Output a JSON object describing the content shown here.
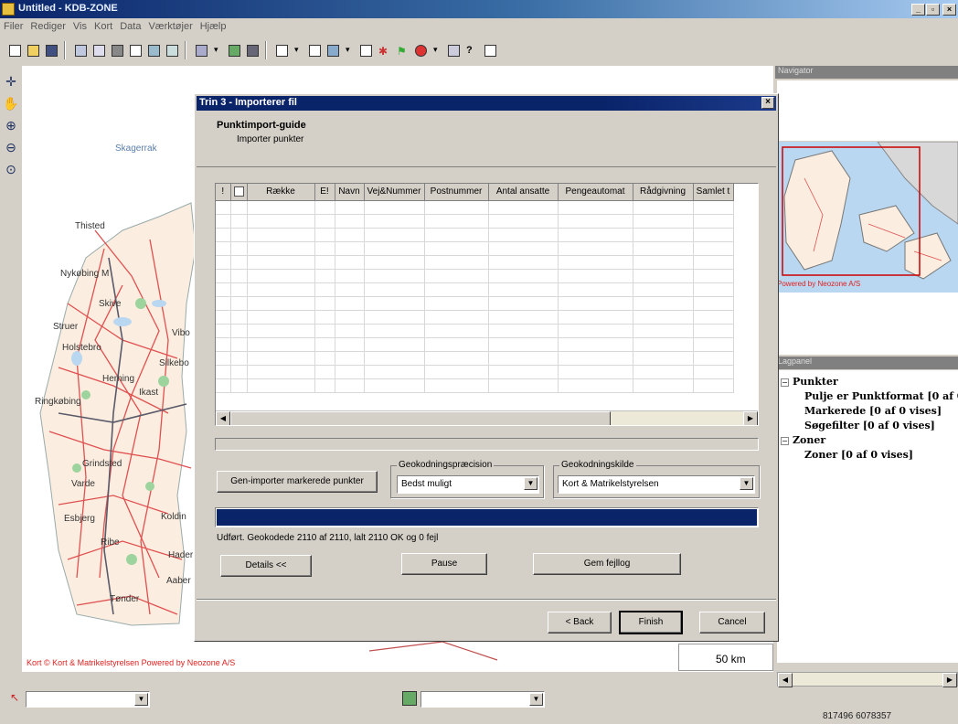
{
  "app": {
    "title": "Untitled - KDB-ZONE",
    "menu": [
      "Filer",
      "Rediger",
      "Vis",
      "Kort",
      "Data",
      "Værktøjer",
      "Hjælp"
    ]
  },
  "map": {
    "labels": {
      "skagerrak": "Skagerrak",
      "thisted": "Thisted",
      "nykobing": "Nykøbing M",
      "skive": "Skive",
      "viborg": "Vibo",
      "struer": "Struer",
      "holstebro": "Holstebro",
      "herning": "Herning",
      "silkeborg": "Silkebo",
      "ringkobing": "Ringkøbing",
      "ikast": "Ikast",
      "grindsted": "Grindsted",
      "varde": "Varde",
      "esbjerg": "Esbjerg",
      "kolding": "Koldin",
      "ribe": "Ribe",
      "haderslev": "Hader",
      "aabenraa": "Aaber",
      "tonder": "Tønder"
    },
    "credit": "Kort © Kort & Matrikelstyrelsen Powered by Neozone A/S",
    "scale": "50 km"
  },
  "navigator": {
    "title": "Navigator",
    "credit": "Powered by Neozone A/S"
  },
  "layers": {
    "title": "Lagpanel",
    "groups": [
      {
        "label": "Punkter",
        "expander": "−",
        "children": [
          "Pulje er Punktformat [0 af 0",
          "Markerede [0 af 0 vises]",
          "Søgefilter [0 af 0 vises]"
        ]
      },
      {
        "label": "Zoner",
        "expander": "−",
        "children": [
          "Zoner [0 af 0 vises]"
        ]
      }
    ]
  },
  "statusbar": {
    "coords": "817496 6078357"
  },
  "dialog": {
    "title": "Trin 3 - Importerer fil",
    "close": "×",
    "heading": "Punktimport-guide",
    "subheading": "Importer punkter",
    "grid": {
      "columns": [
        "!",
        "",
        "Række",
        "E!",
        "Navn",
        "Vej&Nummer",
        "Postnummer",
        "Antal ansatte",
        "Pengeautomat",
        "Rådgivning",
        "Samlet t"
      ],
      "empty_rows": 14
    },
    "regen_button": "Gen-importer markerede punkter",
    "precision": {
      "legend": "Geokodningspræcision",
      "value": "Bedst muligt"
    },
    "source": {
      "legend": "Geokodningskilde",
      "value": "Kort & Matrikelstyrelsen"
    },
    "progress": 1.0,
    "status": "Udført. Geokodede 2110 af 2110, lalt 2110 OK og 0 fejl",
    "details_button": "Details <<",
    "pause_button": "Pause",
    "save_log_button": "Gem fejllog",
    "back_button": "< Back",
    "finish_button": "Finish",
    "cancel_button": "Cancel"
  },
  "colors": {
    "titlebar": "#0a246a",
    "progress": "#0a246a",
    "road": "#e05050",
    "water": "#b9d7f0",
    "credit": "#e02020"
  }
}
